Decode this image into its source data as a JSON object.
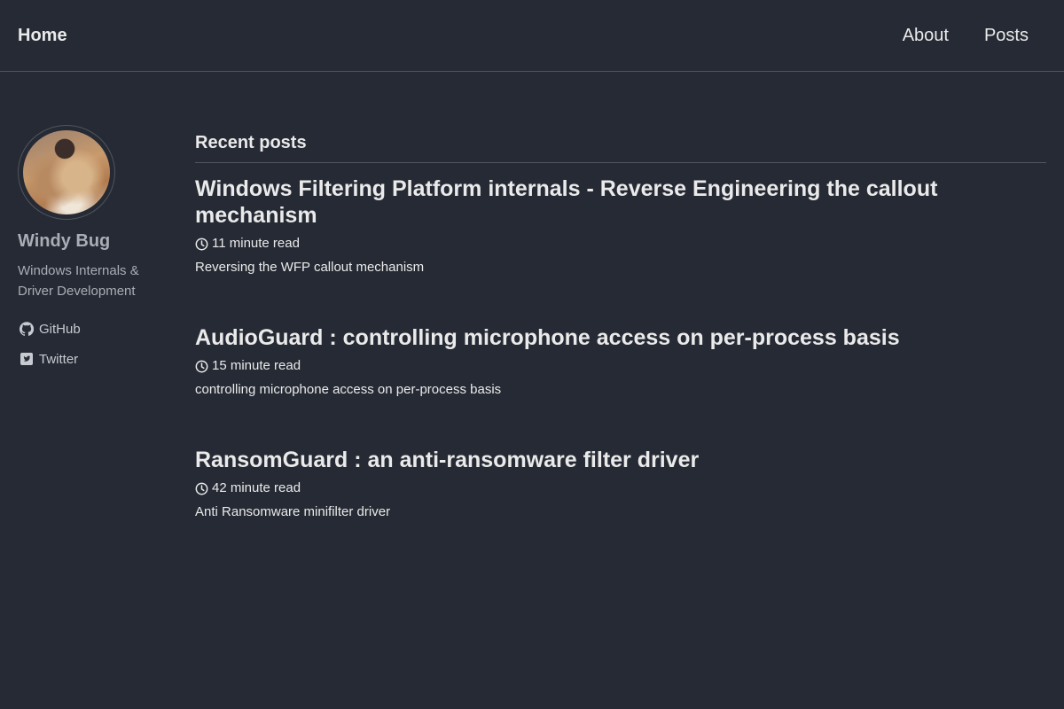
{
  "header": {
    "site_title": "Home",
    "nav": [
      {
        "label": "About"
      },
      {
        "label": "Posts"
      }
    ]
  },
  "sidebar": {
    "author_name": "Windy Bug",
    "author_bio": "Windows Internals & Driver Development",
    "social": [
      {
        "label": "GitHub",
        "icon": "github-icon"
      },
      {
        "label": "Twitter",
        "icon": "twitter-icon"
      }
    ]
  },
  "main": {
    "section_title": "Recent posts",
    "posts": [
      {
        "title": "Windows Filtering Platform internals - Reverse Engineering the callout mechanism",
        "read_time": "11 minute read",
        "excerpt": "Reversing the WFP callout mechanism"
      },
      {
        "title": "AudioGuard : controlling microphone access on per-process basis",
        "read_time": "15 minute read",
        "excerpt": "controlling microphone access on per-process basis"
      },
      {
        "title": "RansomGuard : an anti-ransomware filter driver",
        "read_time": "42 minute read",
        "excerpt": "Anti Ransomware minifilter driver"
      }
    ]
  },
  "colors": {
    "background": "#252a34",
    "text": "#eaeaea",
    "muted": "#a9adb5",
    "border": "#51555d"
  }
}
